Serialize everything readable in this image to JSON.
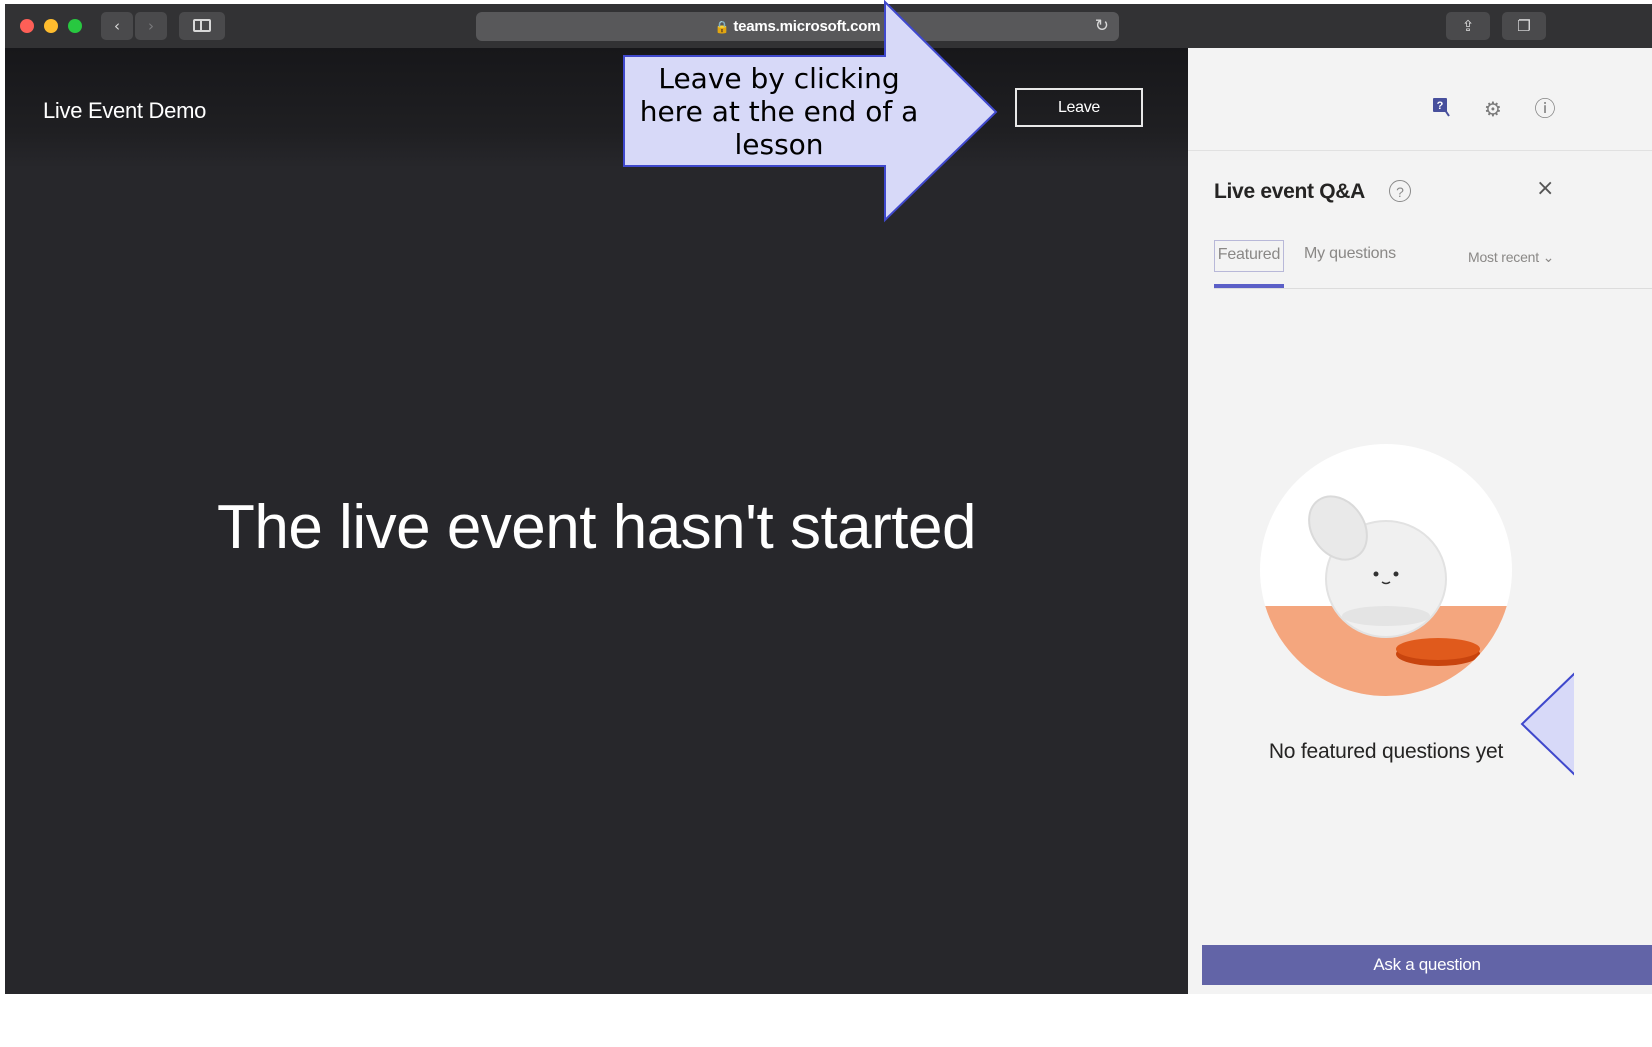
{
  "browser": {
    "url": "teams.microsoft.com",
    "lock_icon": "lock-icon",
    "reload_icon": "reload-icon"
  },
  "stage": {
    "event_title": "Live Event Demo",
    "leave_label": "Leave",
    "status_message": "The live event hasn't started"
  },
  "qa": {
    "title": "Live event Q&A",
    "help_glyph": "?",
    "close_glyph": "×",
    "tabs": [
      {
        "label": "Featured",
        "active": true
      },
      {
        "label": "My questions",
        "active": false
      }
    ],
    "sort_label": "Most recent",
    "sort_chevron": "⌄",
    "empty_message": "No featured questions yet",
    "ask_label": "Ask a question"
  },
  "annotation": {
    "text": "Leave by clicking here at the end of a lesson",
    "fill": "#d7d9f8",
    "stroke": "#3f48cc"
  },
  "colors": {
    "accent": "#6264a7",
    "stage_bg": "#27272b",
    "panel_bg": "#f3f3f3",
    "illustration_orange": "#f4a67e"
  }
}
